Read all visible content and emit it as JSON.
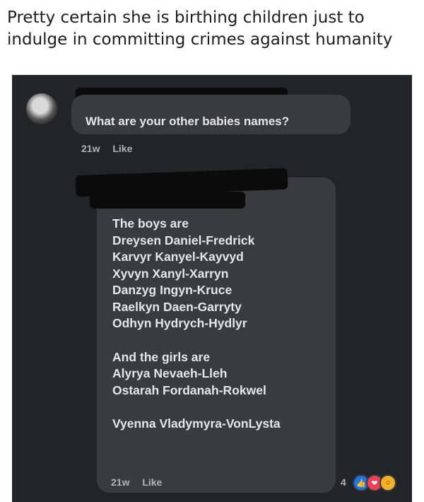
{
  "caption": "Pretty certain she is birthing children just to indulge in committing crimes against humanity",
  "comment1": {
    "text": "What are your other babies names?",
    "time": "21w",
    "like": "Like"
  },
  "comment2": {
    "lines_boys": [
      "The boys are",
      "Dreysen Daniel-Fredrick",
      "Karvyr Kanyel-Kayvyd",
      "Xyvyn Xanyl-Xarryn",
      "Danzyg Ingyn-Kruce",
      "Raelkyn Daen-Garryty",
      "Odhyn Hydrych-Hydlyr"
    ],
    "lines_girls": [
      "And the girls are",
      "Alyrya Nevaeh-Lleh",
      "Ostarah Fordanah-Rokwel"
    ],
    "last_line": "Vyenna Vladymyra-VonLysta",
    "time": "21w",
    "like": "Like",
    "reaction_count": "4"
  },
  "icons": {
    "like_reaction": "thumbs-up-icon",
    "love_reaction": "heart-icon",
    "wow_reaction": "wow-face-icon"
  },
  "colors": {
    "background": "#232427",
    "bubble": "#3a3b3f",
    "text": "#e6e6e8",
    "meta": "#b0b3b8",
    "like_blue": "#1877f2",
    "love_red": "#f33e58",
    "wow_yellow": "#f7b125"
  }
}
